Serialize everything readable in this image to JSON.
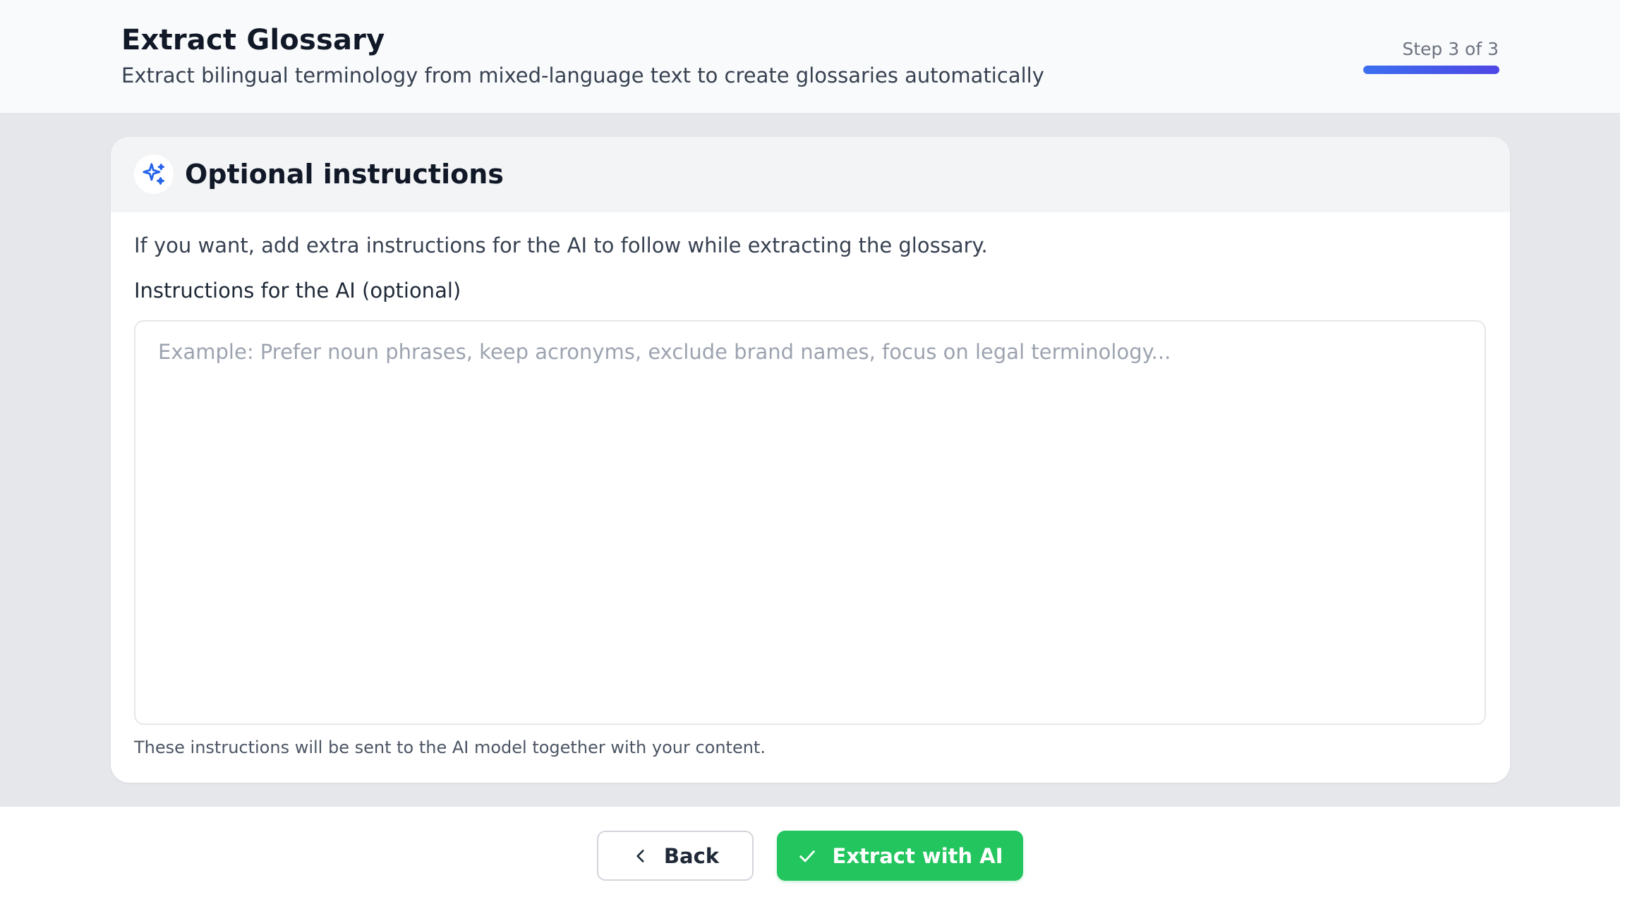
{
  "header": {
    "title": "Extract Glossary",
    "subtitle": "Extract bilingual terminology from mixed-language text to create glossaries automatically",
    "step_label": "Step 3 of 3",
    "progress": 1.0
  },
  "card": {
    "icon": "sparkles-icon",
    "title": "Optional instructions",
    "intro": "If you want, add extra instructions for the AI to follow while extracting the glossary.",
    "field_label": "Instructions for the AI (optional)",
    "textarea": {
      "value": "",
      "placeholder": "Example: Prefer noun phrases, keep acronyms, exclude brand names, focus on legal terminology..."
    },
    "helper": "These instructions will be sent to the AI model together with your content."
  },
  "footer": {
    "back_label": "Back",
    "back_icon": "chevron-left-icon",
    "extract_label": "Extract with AI",
    "extract_icon": "check-icon"
  },
  "colors": {
    "accent_blue": "#3b6ff0",
    "accent_indigo": "#4f46e5",
    "success_green": "#22c55e",
    "page_gray": "#e5e7eb"
  }
}
